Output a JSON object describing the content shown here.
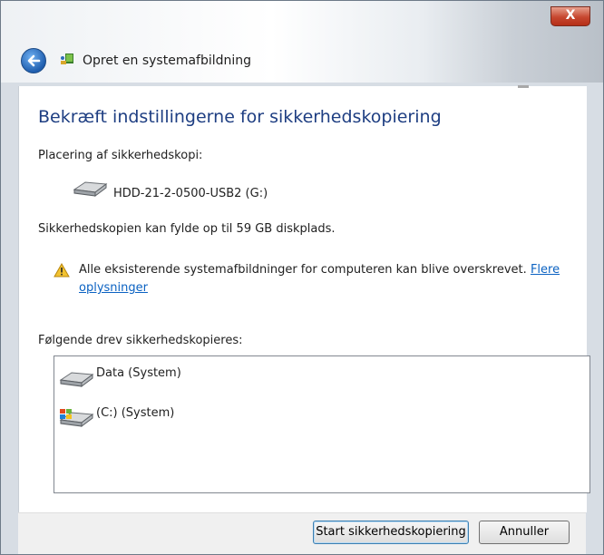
{
  "window": {
    "title": "Opret en systemafbildning",
    "close_label": "X"
  },
  "main": {
    "heading": "Bekræft indstillingerne for sikkerhedskopiering",
    "location_label": "Placering af sikkerhedskopi:",
    "location_drive": "HDD-21-2-0500-USB2 (G:)",
    "space_text": "Sikkerhedskopien kan fylde op til 59 GB diskplads.",
    "warning_text": "Alle eksisterende systemafbildninger for computeren kan blive overskrevet.",
    "warning_link_line1": "Flere",
    "warning_link_line2": "oplysninger",
    "drives_label": "Følgende drev sikkerhedskopieres:",
    "drives": [
      {
        "name": "Data (System)",
        "icon": "hard-drive-icon"
      },
      {
        "name": "(C:) (System)",
        "icon": "windows-drive-icon"
      }
    ]
  },
  "footer": {
    "start_button": "Start sikkerhedskopiering",
    "cancel_button": "Annuller"
  },
  "colors": {
    "heading": "#1e3e82",
    "link": "#0b62c2",
    "close_button": "#c6472f"
  }
}
